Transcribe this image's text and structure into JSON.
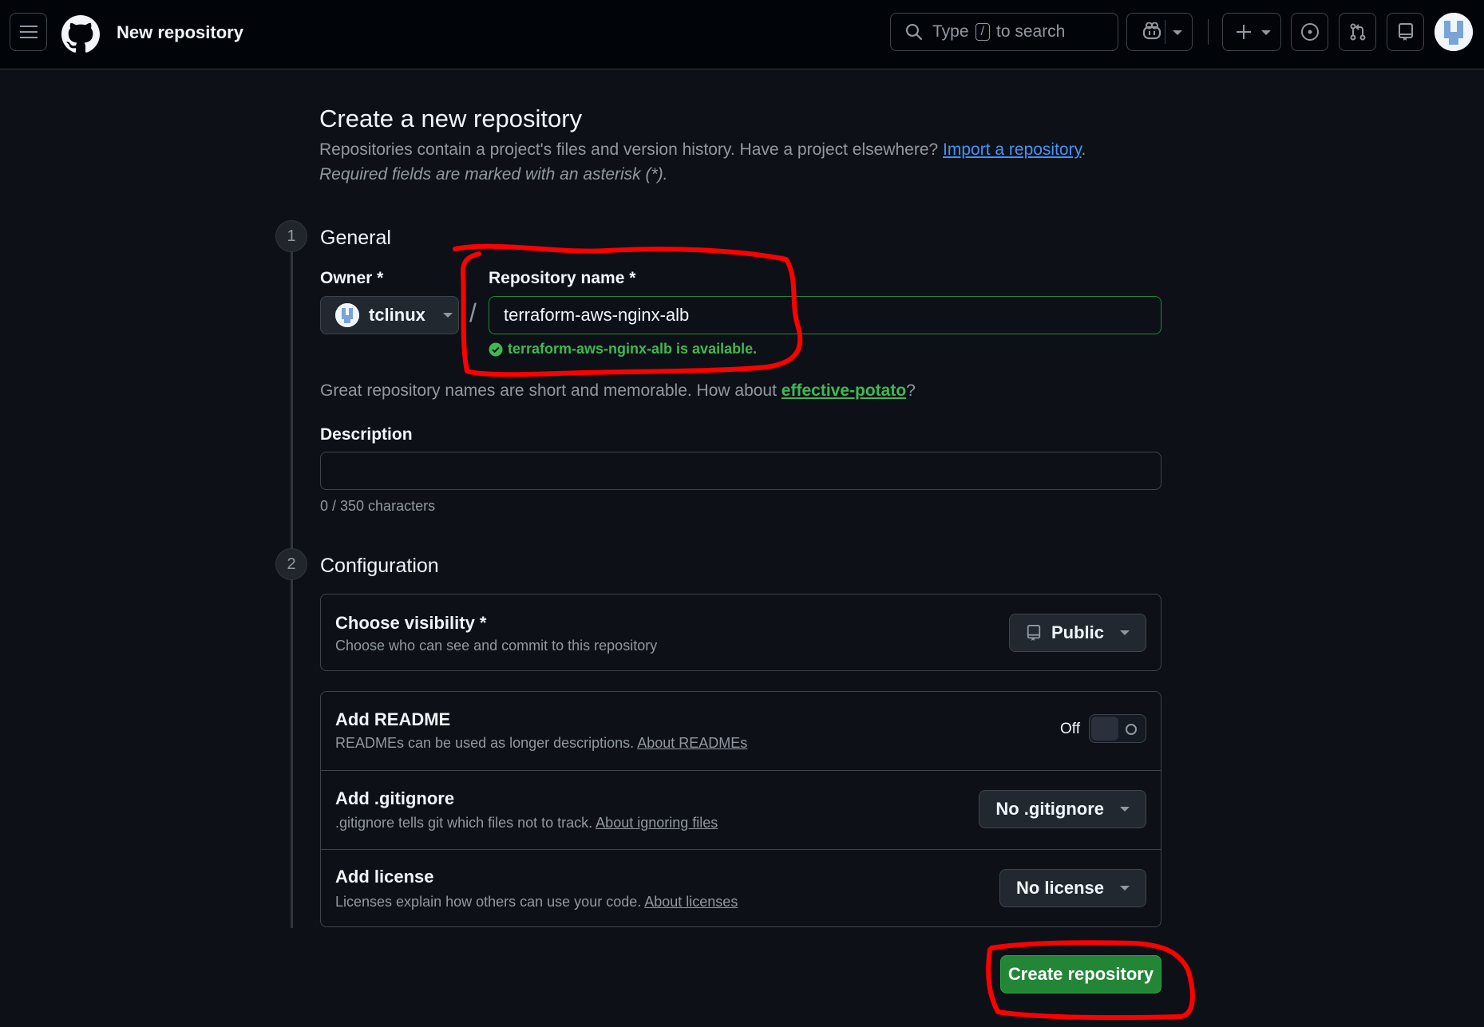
{
  "header": {
    "page_name": "New repository",
    "search": {
      "prefix": "Type",
      "key": "/",
      "suffix": "to search"
    }
  },
  "page": {
    "title": "Create a new repository",
    "intro": "Repositories contain a project's files and version history. Have a project elsewhere?",
    "import_link": "Import a repository",
    "required_note": "Required fields are marked with an asterisk (*)."
  },
  "general": {
    "step": "1",
    "title": "General",
    "owner_label": "Owner *",
    "owner_value": "tclinux",
    "separator": "/",
    "repo_name_label": "Repository name *",
    "repo_name_value": "terraform-aws-nginx-alb",
    "availability": "terraform-aws-nginx-alb is available.",
    "suggestion_text": "Great repository names are short and memorable. How about",
    "suggestion_name": "effective-potato",
    "suggestion_end": "?",
    "description_label": "Description",
    "description_value": "",
    "char_count": "0 / 350 characters"
  },
  "configuration": {
    "step": "2",
    "title": "Configuration",
    "visibility": {
      "title": "Choose visibility *",
      "subtitle": "Choose who can see and commit to this repository",
      "value": "Public"
    },
    "readme": {
      "title": "Add README",
      "subtitle": "READMEs can be used as longer descriptions.",
      "link": "About READMEs",
      "toggle_label": "Off",
      "enabled": false
    },
    "gitignore": {
      "title": "Add .gitignore",
      "subtitle": ".gitignore tells git which files not to track.",
      "link": "About ignoring files",
      "value": "No .gitignore"
    },
    "license": {
      "title": "Add license",
      "subtitle": "Licenses explain how others can use your code.",
      "link": "About licenses",
      "value": "No license"
    }
  },
  "actions": {
    "create_label": "Create repository"
  },
  "colors": {
    "accent_green": "#238636",
    "link_blue": "#4493f8",
    "annotation_red": "#ff0000"
  },
  "icons": [
    "menu-icon",
    "github-logo-icon",
    "search-icon",
    "copilot-icon",
    "plus-icon",
    "issues-icon",
    "pull-requests-icon",
    "repo-icon",
    "check-circle-icon",
    "chevron-down-icon"
  ]
}
